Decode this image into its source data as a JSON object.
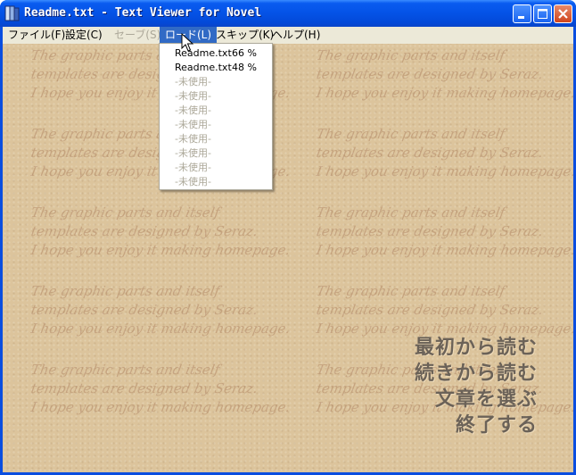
{
  "window": {
    "title": "Readme.txt - Text Viewer for Novel",
    "controls": [
      "minimize-icon",
      "maximize-icon",
      "close-icon"
    ]
  },
  "menubar": {
    "items": [
      {
        "label": "ファイル(F)",
        "enabled": true
      },
      {
        "label": "設定(C)",
        "enabled": true
      },
      {
        "label": "セーブ(S)",
        "enabled": false
      },
      {
        "label": "ロード(L)",
        "enabled": true,
        "open": true
      },
      {
        "label": "スキップ(K)",
        "enabled": true
      },
      {
        "label": "ヘルプ(H)",
        "enabled": true
      }
    ]
  },
  "load_menu": {
    "saved": [
      {
        "name": "Readme.txt",
        "percent": "66 %"
      },
      {
        "name": "Readme.txt",
        "percent": "48 %"
      }
    ],
    "unused_slots": [
      "-未使用-",
      "-未使用-",
      "-未使用-",
      "-未使用-",
      "-未使用-",
      "-未使用-",
      "-未使用-",
      "-未使用-"
    ]
  },
  "main_menu": {
    "items": [
      "最初から読む",
      "続きから読む",
      "文章を選ぶ",
      "終了する"
    ]
  },
  "background": {
    "script_lines": [
      "The graphic parts and itself",
      "templates are designed by Seraz.",
      "I hope you enjoy it making homepage."
    ]
  }
}
